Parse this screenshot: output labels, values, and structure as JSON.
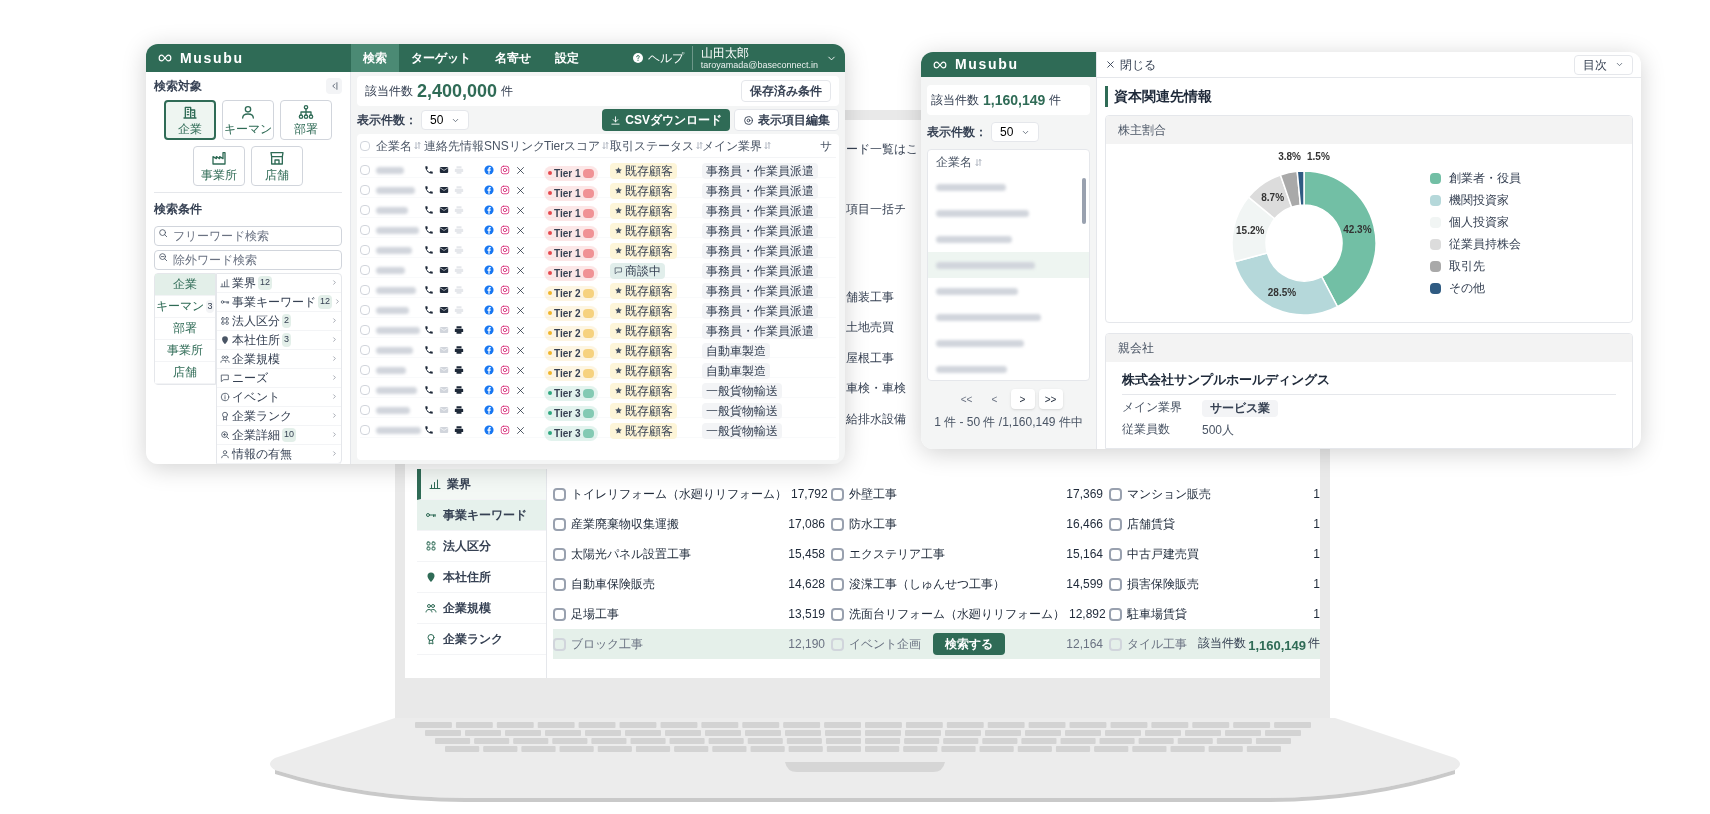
{
  "left_window": {
    "logo": "Musubu",
    "nav_tabs": [
      {
        "label": "検索",
        "selected": true
      },
      {
        "label": "ターゲット",
        "selected": false
      },
      {
        "label": "名寄せ",
        "selected": false
      },
      {
        "label": "設定",
        "selected": false
      }
    ],
    "help": "ヘルプ",
    "user": {
      "name": "山田太郎",
      "email": "taroyamada@baseconnect.in"
    },
    "sidebar": {
      "target_heading": "検索対象",
      "targets": [
        {
          "label": "企業",
          "kind": "building",
          "selected": true
        },
        {
          "label": "キーマン",
          "kind": "person",
          "selected": false
        },
        {
          "label": "部署",
          "kind": "org",
          "selected": false
        },
        {
          "label": "事業所",
          "kind": "factory",
          "selected": false
        },
        {
          "label": "店舗",
          "kind": "shop",
          "selected": false
        }
      ],
      "conditions_heading": "検索条件",
      "search_fields": [
        {
          "kind": "search",
          "placeholder": "フリーワード検索"
        },
        {
          "kind": "exclude",
          "placeholder": "除外ワード検索"
        }
      ],
      "categories": [
        {
          "label": "企業",
          "selected": true
        },
        {
          "label": "キーマン",
          "count": "3",
          "selected": false
        },
        {
          "label": "部署",
          "selected": false
        },
        {
          "label": "事業所",
          "selected": false
        },
        {
          "label": "店舗",
          "selected": false
        }
      ],
      "filters": [
        {
          "label": "業界",
          "count": "12",
          "kind": "industry"
        },
        {
          "label": "事業キーワード",
          "count": "12",
          "kind": "keyword"
        },
        {
          "label": "法人区分",
          "count": "2",
          "kind": "corp"
        },
        {
          "label": "本社住所",
          "count": "3",
          "kind": "pin"
        },
        {
          "label": "企業規模",
          "kind": "people"
        },
        {
          "label": "ニーズ",
          "kind": "chat"
        },
        {
          "label": "イベント",
          "kind": "info"
        },
        {
          "label": "企業ランク",
          "kind": "rank"
        },
        {
          "label": "企業詳細",
          "count": "10",
          "kind": "detail"
        },
        {
          "label": "情報の有無",
          "kind": "person"
        }
      ]
    },
    "result_count": {
      "label": "該当件数",
      "value": "2,400,000",
      "unit": "件"
    },
    "saved_button": "保存済み条件",
    "per_page": {
      "label": "表示件数：",
      "value": "50"
    },
    "csv_button": "CSVダウンロード",
    "columns_button": "表示項目編集",
    "table": {
      "select_all_checked": false,
      "columns": [
        {
          "label": "企業名",
          "sortable": true
        },
        {
          "label": "連絡先情報",
          "sortable": false
        },
        {
          "label": "SNSリンク",
          "sortable": false
        },
        {
          "label": "Tierスコア",
          "sortable": true
        },
        {
          "label": "取引ステータス",
          "sortable": true
        },
        {
          "label": "メイン業界",
          "sortable": true
        },
        {
          "label": "サ",
          "sortable": false
        }
      ],
      "rows": [
        {
          "checked": false,
          "email": true,
          "fax": false,
          "tier": "Tier 1",
          "color": "#e5484d",
          "status": {
            "label": "既存顧客",
            "kind": "customer"
          },
          "industry": "事務員・作業員派遣"
        },
        {
          "checked": false,
          "email": true,
          "fax": false,
          "tier": "Tier 1",
          "color": "#e5484d",
          "status": {
            "label": "既存顧客",
            "kind": "customer"
          },
          "industry": "事務員・作業員派遣"
        },
        {
          "checked": false,
          "email": true,
          "fax": false,
          "tier": "Tier 1",
          "color": "#e5484d",
          "status": {
            "label": "既存顧客",
            "kind": "customer"
          },
          "industry": "事務員・作業員派遣"
        },
        {
          "checked": false,
          "email": true,
          "fax": false,
          "tier": "Tier 1",
          "color": "#e5484d",
          "status": {
            "label": "既存顧客",
            "kind": "customer"
          },
          "industry": "事務員・作業員派遣"
        },
        {
          "checked": false,
          "email": true,
          "fax": false,
          "tier": "Tier 1",
          "color": "#e5484d",
          "status": {
            "label": "既存顧客",
            "kind": "customer"
          },
          "industry": "事務員・作業員派遣"
        },
        {
          "checked": false,
          "email": true,
          "fax": false,
          "tier": "Tier 1",
          "color": "#e5484d",
          "status": {
            "label": "商談中",
            "kind": "negotiating"
          },
          "industry": "事務員・作業員派遣"
        },
        {
          "checked": false,
          "email": true,
          "fax": false,
          "tier": "Tier 2",
          "color": "#f0b429",
          "status": {
            "label": "既存顧客",
            "kind": "customer"
          },
          "industry": "事務員・作業員派遣"
        },
        {
          "checked": false,
          "email": true,
          "fax": false,
          "tier": "Tier 2",
          "color": "#f0b429",
          "status": {
            "label": "既存顧客",
            "kind": "customer"
          },
          "industry": "事務員・作業員派遣"
        },
        {
          "checked": false,
          "email": false,
          "fax": true,
          "tier": "Tier 2",
          "color": "#f0b429",
          "status": {
            "label": "既存顧客",
            "kind": "customer"
          },
          "industry": "事務員・作業員派遣"
        },
        {
          "checked": false,
          "email": false,
          "fax": true,
          "tier": "Tier 2",
          "color": "#f0b429",
          "status": {
            "label": "既存顧客",
            "kind": "customer"
          },
          "industry": "自動車製造"
        },
        {
          "checked": false,
          "email": false,
          "fax": true,
          "tier": "Tier 2",
          "color": "#f0b429",
          "status": {
            "label": "既存顧客",
            "kind": "customer"
          },
          "industry": "自動車製造"
        },
        {
          "checked": false,
          "email": false,
          "fax": true,
          "tier": "Tier 3",
          "color": "#2fa77f",
          "status": {
            "label": "既存顧客",
            "kind": "customer"
          },
          "industry": "一般貨物輸送"
        },
        {
          "checked": false,
          "email": false,
          "fax": true,
          "tier": "Tier 3",
          "color": "#2fa77f",
          "status": {
            "label": "既存顧客",
            "kind": "customer"
          },
          "industry": "一般貨物輸送"
        },
        {
          "checked": false,
          "email": false,
          "fax": true,
          "tier": "Tier 3",
          "color": "#2fa77f",
          "status": {
            "label": "既存顧客",
            "kind": "customer"
          },
          "industry": "一般貨物輸送"
        }
      ]
    }
  },
  "right_window": {
    "logo": "Musubu",
    "result_count": {
      "label": "該当件数",
      "value": "1,160,149",
      "unit": "件"
    },
    "per_page": {
      "label": "表示件数：",
      "value": "50"
    },
    "list_header": "企業名",
    "pagination": [
      {
        "label": "<<",
        "disabled": true
      },
      {
        "label": "<",
        "disabled": true
      },
      {
        "label": ">",
        "disabled": false
      },
      {
        "label": ">>",
        "disabled": false
      }
    ],
    "range": "1 件 - 50 件 /1,160,149 件中",
    "close": "閉じる",
    "toc": "目次",
    "section_title": "資本関連先情報",
    "shareholder_card": {
      "chart_data": {
        "type": "donut",
        "title": "株主割合",
        "categories": [
          "創業者・役員",
          "機関投資家",
          "個人投資家",
          "従業員持株会",
          "取引先",
          "その他"
        ],
        "series": [
          {
            "values": [
              42.3,
              28.5,
              15.2,
              8.7,
              3.8,
              1.5
            ]
          }
        ],
        "colors": [
          "#72bfa5",
          "#b5d8da",
          "#f1f5f4",
          "#dcdcdc",
          "#a9a9a9",
          "#2f5b82"
        ],
        "value_labels": [
          "42.3%",
          "28.5%",
          "15.2%",
          "8.7%",
          "3.8%",
          "1.5%"
        ]
      }
    },
    "parent_card": {
      "title": "親会社",
      "company": "株式会社サンプルホールディングス",
      "fields": [
        {
          "label": "メイン業界",
          "value": "サービス業",
          "kind": "tag"
        },
        {
          "label": "従業員数",
          "value": "500人",
          "kind": "text"
        }
      ]
    }
  },
  "laptop": {
    "fragments": [
      "ード一覧はこ",
      "項目一括チ",
      "舗装工事",
      "土地売買",
      "屋根工事",
      "車検・車検",
      "給排水設備"
    ],
    "nav": [
      {
        "label": "業界",
        "kind": "industry",
        "selected": true,
        "highlighted": false
      },
      {
        "label": "事業キーワード",
        "kind": "keyword",
        "selected": false,
        "highlighted": true
      },
      {
        "label": "法人区分",
        "kind": "corp",
        "selected": false,
        "highlighted": false
      },
      {
        "label": "本社住所",
        "kind": "pin",
        "selected": false,
        "highlighted": false
      },
      {
        "label": "企業規模",
        "kind": "people",
        "selected": false,
        "highlighted": false
      },
      {
        "label": "企業ランク",
        "kind": "rank",
        "selected": false,
        "highlighted": false
      }
    ],
    "keyword_rows": [
      {
        "dimmed": false,
        "items": [
          {
            "label": "トイレリフォーム（水廻りリフォーム）",
            "count": "17,792",
            "checked": false
          },
          {
            "label": "外壁工事",
            "count": "17,369",
            "checked": false
          },
          {
            "label": "マンション販売",
            "count": "1",
            "checked": false
          }
        ]
      },
      {
        "dimmed": false,
        "items": [
          {
            "label": "産業廃棄物収集運搬",
            "count": "17,086",
            "checked": false
          },
          {
            "label": "防水工事",
            "count": "16,466",
            "checked": false
          },
          {
            "label": "店舗賃貸",
            "count": "1",
            "checked": false
          }
        ]
      },
      {
        "dimmed": false,
        "items": [
          {
            "label": "太陽光パネル設置工事",
            "count": "15,458",
            "checked": false
          },
          {
            "label": "エクステリア工事",
            "count": "15,164",
            "checked": false
          },
          {
            "label": "中古戸建売買",
            "count": "1",
            "checked": false
          }
        ]
      },
      {
        "dimmed": false,
        "items": [
          {
            "label": "自動車保険販売",
            "count": "14,628",
            "checked": false
          },
          {
            "label": "浚渫工事（しゅんせつ工事）",
            "count": "14,599",
            "checked": false
          },
          {
            "label": "損害保険販売",
            "count": "1",
            "checked": false
          }
        ]
      },
      {
        "dimmed": false,
        "items": [
          {
            "label": "足場工事",
            "count": "13,519",
            "checked": false
          },
          {
            "label": "洗面台リフォーム（水廻りリフォーム）",
            "count": "12,892",
            "checked": false
          },
          {
            "label": "駐車場賃貸",
            "count": "1",
            "checked": false
          }
        ]
      },
      {
        "dimmed": true,
        "items": [
          {
            "label": "ブロック工事",
            "count": "12,190",
            "checked": false
          },
          {
            "label": "イベント企画",
            "count": "12,164",
            "checked": false
          },
          {
            "label": "タイル工事",
            "checked": false
          }
        ]
      }
    ],
    "footer": {
      "button": "検索する",
      "count_label": "該当件数",
      "count": "1,160,149",
      "unit": "件"
    }
  }
}
